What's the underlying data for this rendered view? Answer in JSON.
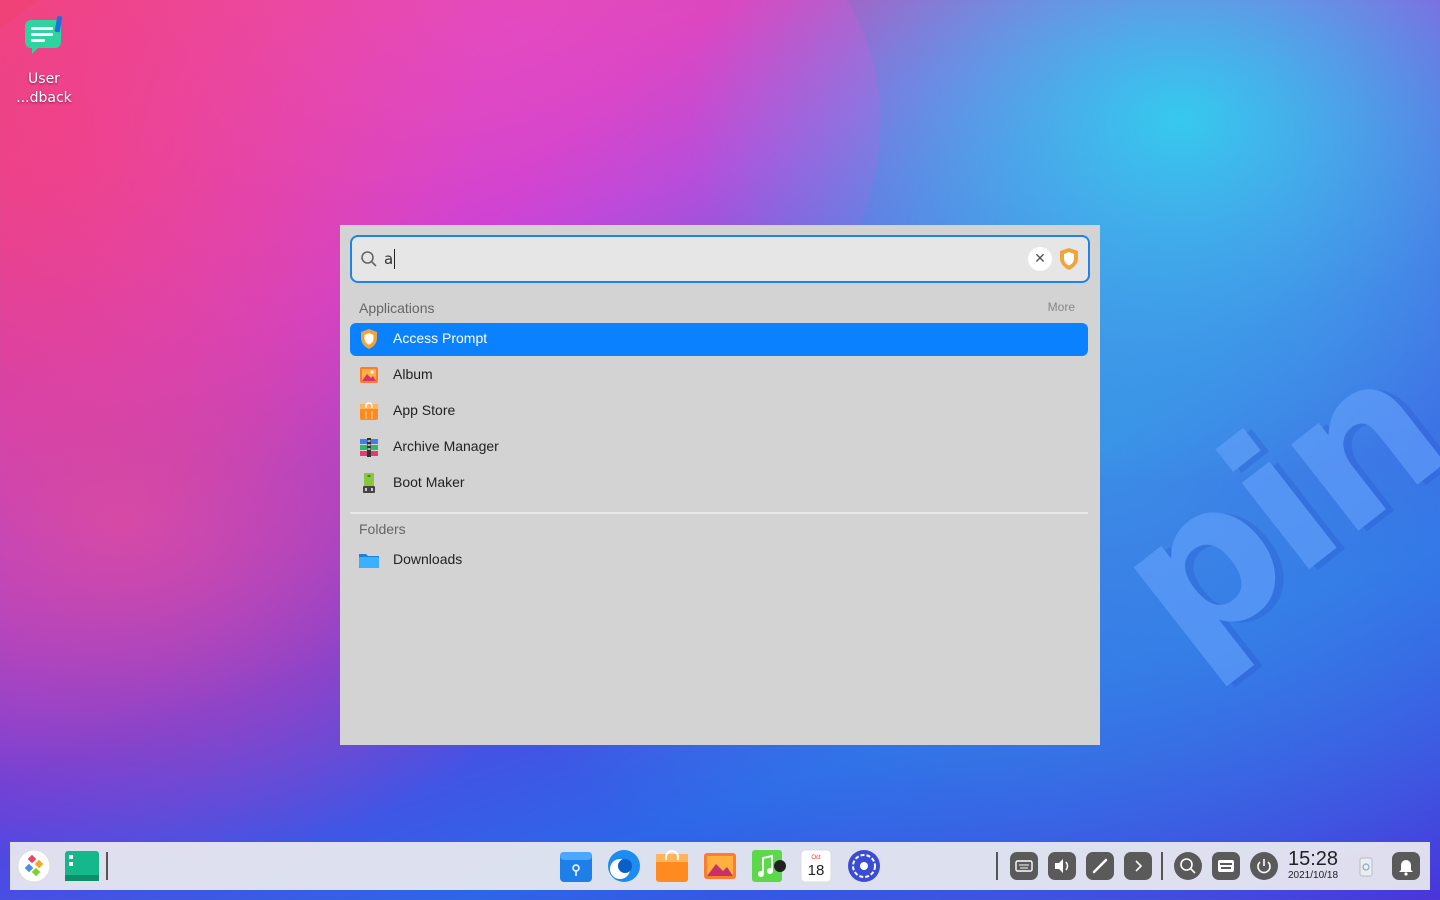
{
  "desktop": {
    "icons": [
      {
        "name": "User Feedback",
        "label_line1": "User",
        "label_line2": "...dback"
      }
    ],
    "wallpaper_watermark": "pin"
  },
  "launcher": {
    "search": {
      "value": "a",
      "clear_icon": "close-icon",
      "right_icon": "shield-icon"
    },
    "sections": {
      "applications": {
        "title": "Applications",
        "more_label": "More",
        "items": [
          {
            "label": "Access Prompt",
            "icon": "shield-icon",
            "selected": true
          },
          {
            "label": "Album",
            "icon": "album-icon",
            "selected": false
          },
          {
            "label": "App Store",
            "icon": "app-store-icon",
            "selected": false
          },
          {
            "label": "Archive Manager",
            "icon": "archive-icon",
            "selected": false
          },
          {
            "label": "Boot Maker",
            "icon": "boot-maker-icon",
            "selected": false
          }
        ]
      },
      "folders": {
        "title": "Folders",
        "items": [
          {
            "label": "Downloads",
            "icon": "folder-icon"
          }
        ]
      }
    }
  },
  "dock": {
    "apps": [
      "launcher-icon",
      "multitasking-icon",
      "file-manager-icon",
      "browser-icon",
      "app-store-icon",
      "album-icon",
      "music-icon",
      "calendar-icon",
      "control-center-icon"
    ],
    "calendar": {
      "month": "Oct",
      "day": "18"
    },
    "tray": [
      "keyboard-icon",
      "volume-icon",
      "pen-icon",
      "expand-arrow-icon",
      "search-icon",
      "onscreen-keyboard-icon",
      "power-icon"
    ],
    "clock": {
      "time": "15:28",
      "date": "2021/10/18"
    },
    "extras": [
      "trash-icon",
      "notification-icon"
    ]
  },
  "colors": {
    "accent": "#0a81ff",
    "search_border": "#1f82e8",
    "panel_bg": "#d3d3d3"
  }
}
